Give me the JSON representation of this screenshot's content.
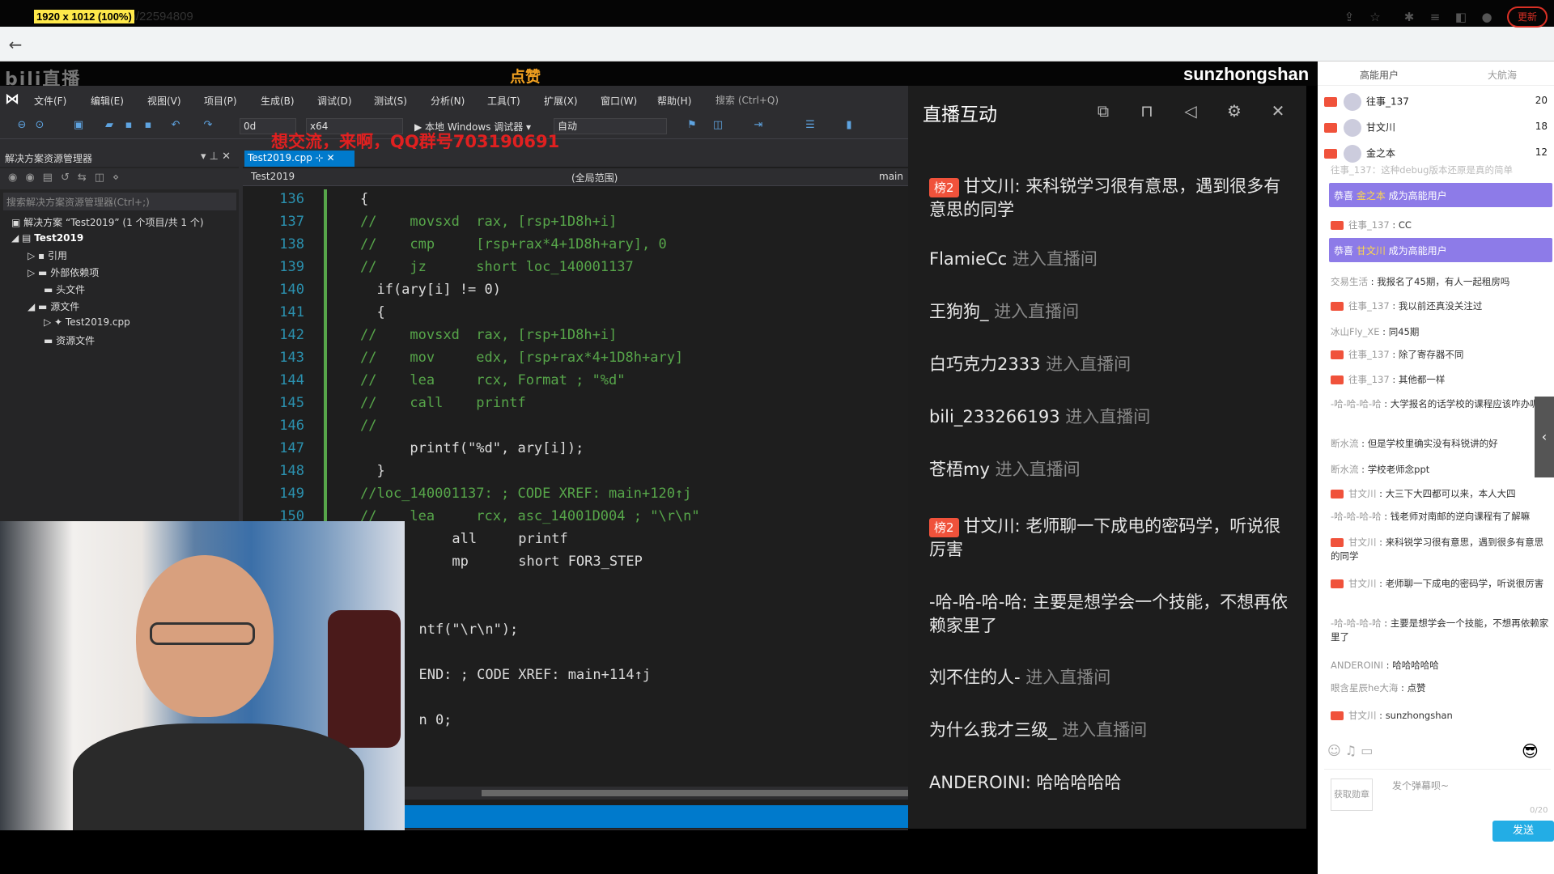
{
  "browser": {
    "zoom_label": "1920 x 1012 (100%)",
    "url": "live.bilibili.com/22594809",
    "update_button": "更新"
  },
  "stream": {
    "logo": "bili直播",
    "like_badge": "点赞",
    "streamer_name": "sunzhongshan",
    "overlay_red_text": "想交流，来啊，QQ群号703190691"
  },
  "vs": {
    "menu": [
      "文件(F)",
      "编辑(E)",
      "视图(V)",
      "项目(P)",
      "生成(B)",
      "调试(D)",
      "测试(S)",
      "分析(N)",
      "工具(T)",
      "扩展(X)",
      "窗口(W)",
      "帮助(H)"
    ],
    "search_placeholder": "搜索 (Ctrl+Q)",
    "toolbar": {
      "config": "0d",
      "platform": "x64",
      "run_label": "▶ 本地 Windows 调试器 ▾",
      "mode": "自动"
    },
    "solution_explorer": {
      "title": "解决方案资源管理器",
      "search_placeholder": "搜索解决方案资源管理器(Ctrl+;)",
      "tree": [
        "解决方案 “Test2019” (1 个项目/共 1 个)",
        "Test2019",
        "引用",
        "外部依赖项",
        "头文件",
        "源文件",
        "Test2019.cpp",
        "资源文件"
      ]
    },
    "tab_name": "Test2019.cpp",
    "nav_project": "Test2019",
    "nav_scope": "(全局范围)",
    "nav_func": "main",
    "lines": [
      {
        "n": "136",
        "code": "{"
      },
      {
        "n": "137",
        "code": "//    movsxd  rax, [rsp+1D8h+i]"
      },
      {
        "n": "138",
        "code": "//    cmp     [rsp+rax*4+1D8h+ary], 0"
      },
      {
        "n": "139",
        "code": "//    jz      short loc_140001137"
      },
      {
        "n": "140",
        "code": "  if(ary[i] != 0)"
      },
      {
        "n": "141",
        "code": "  {"
      },
      {
        "n": "142",
        "code": "//    movsxd  rax, [rsp+1D8h+i]"
      },
      {
        "n": "143",
        "code": "//    mov     edx, [rsp+rax*4+1D8h+ary]"
      },
      {
        "n": "144",
        "code": "//    lea     rcx, Format ; \"%d\""
      },
      {
        "n": "145",
        "code": "//    call    printf"
      },
      {
        "n": "146",
        "code": "//"
      },
      {
        "n": "147",
        "code": "      printf(\"%d\", ary[i]);"
      },
      {
        "n": "148",
        "code": "  }"
      },
      {
        "n": "149",
        "code": "//loc_140001137: ; CODE XREF: main+120↑j"
      },
      {
        "n": "150",
        "code": "//    lea     rcx, asc_14001D004 ; \"\\r\\n\""
      },
      {
        "n": "",
        "code": "      all     printf"
      },
      {
        "n": "",
        "code": "      mp      short FOR3_STEP"
      },
      {
        "n": "",
        "code": ""
      },
      {
        "n": "",
        "code": ""
      },
      {
        "n": "",
        "code": "  ntf(\"\\r\\n\");"
      },
      {
        "n": "",
        "code": ""
      },
      {
        "n": "",
        "code": "  END: ; CODE XREF: main+114↑j"
      },
      {
        "n": "",
        "code": ""
      },
      {
        "n": "",
        "code": "  n 0;"
      }
    ]
  },
  "live": {
    "title": "直播互动",
    "messages": [
      {
        "level": "榜2",
        "user": "甘文川",
        "text": "来科锐学习很有意思，遇到很多有意思的同学"
      },
      {
        "level": "",
        "user": "FlamieCc",
        "text": "进入直播间"
      },
      {
        "level": "",
        "user": "王狗狗_",
        "text": "进入直播间"
      },
      {
        "level": "",
        "user": "白巧克力2333",
        "text": "进入直播间"
      },
      {
        "level": "",
        "user": "bili_233266193",
        "text": "进入直播间"
      },
      {
        "level": "",
        "user": "苍梧my",
        "text": "进入直播间"
      },
      {
        "level": "榜2",
        "user": "甘文川",
        "text": "老师聊一下成电的密码学，听说很厉害"
      },
      {
        "level": "",
        "user": "-哈-哈-哈-哈",
        "text": "主要是想学会一个技能，不想再依赖家里了"
      },
      {
        "level": "",
        "user": "刘不住的人-",
        "text": "进入直播间"
      },
      {
        "level": "",
        "user": "为什么我才三级_",
        "text": "进入直播间"
      },
      {
        "level": "",
        "user": "ANDEROINI",
        "text": "哈哈哈哈哈"
      }
    ]
  },
  "chat": {
    "tabs": [
      "高能用户",
      "大航海"
    ],
    "ranking": [
      {
        "name": "往事_137",
        "score": "20"
      },
      {
        "name": "甘文川",
        "score": "18"
      },
      {
        "name": "金之本",
        "score": "12"
      }
    ],
    "faded_top": "往事_137：这种debug版本还原是真的简单",
    "items": [
      {
        "kind": "cong",
        "prefix": "恭喜 ",
        "name": "金之本",
        "suffix": " 成为高能用户"
      },
      {
        "kind": "msg",
        "badge": true,
        "user": "往事_137",
        "text": "CC"
      },
      {
        "kind": "cong",
        "prefix": "恭喜 ",
        "name": "甘文川",
        "suffix": " 成为高能用户"
      },
      {
        "kind": "msg",
        "badge": false,
        "user": "交易生活",
        "text": "我报名了45期，有人一起租房吗"
      },
      {
        "kind": "msg",
        "badge": true,
        "user": "往事_137",
        "text": "我以前还真没关注过"
      },
      {
        "kind": "msg",
        "badge": false,
        "user": "冰山Fly_XE",
        "text": "同45期"
      },
      {
        "kind": "msg",
        "badge": true,
        "user": "往事_137",
        "text": "除了寄存器不同"
      },
      {
        "kind": "msg",
        "badge": true,
        "user": "往事_137",
        "text": "其他都一样"
      },
      {
        "kind": "msg",
        "badge": false,
        "user": "-哈-哈-哈-哈",
        "text": "大学报名的话学校的课程应该咋办呢?"
      },
      {
        "kind": "msg",
        "badge": false,
        "user": "断水流",
        "text": "但是学校里确实没有科锐讲的好"
      },
      {
        "kind": "msg",
        "badge": false,
        "user": "断水流",
        "text": "学校老师念ppt"
      },
      {
        "kind": "msg",
        "badge": true,
        "user": "甘文川",
        "text": "大三下大四都可以来，本人大四"
      },
      {
        "kind": "msg",
        "badge": false,
        "user": "-哈-哈-哈-哈",
        "text": "钱老师对南邮的逆向课程有了解嘛"
      },
      {
        "kind": "msg",
        "badge": true,
        "user": "甘文川",
        "text": "来科锐学习很有意思，遇到很多有意思的同学"
      },
      {
        "kind": "msg",
        "badge": true,
        "user": "甘文川",
        "text": "老师聊一下成电的密码学，听说很厉害"
      },
      {
        "kind": "msg",
        "badge": false,
        "user": "-哈-哈-哈-哈",
        "text": "主要是想学会一个技能，不想再依赖家里了"
      },
      {
        "kind": "msg",
        "badge": false,
        "user": "ANDEROINI",
        "text": "哈哈哈哈哈"
      },
      {
        "kind": "msg",
        "badge": false,
        "user": "眼含星辰he大海",
        "text": "点赞"
      },
      {
        "kind": "msg",
        "badge": true,
        "user": "甘文川",
        "text": "sunzhongshan"
      }
    ],
    "get_medal": "获取勋章",
    "input_placeholder": "发个弹幕呗~",
    "counter": "0/20",
    "send_label": "发送"
  }
}
